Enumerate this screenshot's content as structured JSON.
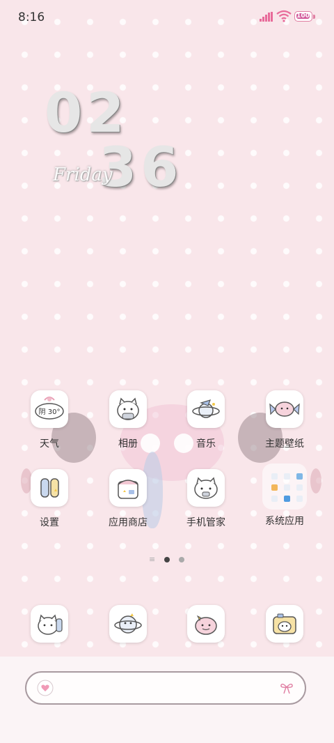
{
  "status_bar": {
    "time": "8:16",
    "battery": "100"
  },
  "clock": {
    "hours": "02",
    "minutes": "36",
    "day": "Friday"
  },
  "weather_widget": {
    "text": "阴 30°"
  },
  "apps_row1": [
    {
      "label": "天气",
      "icon": "weather-cloud-icon"
    },
    {
      "label": "相册",
      "icon": "gallery-cat-icon"
    },
    {
      "label": "音乐",
      "icon": "music-planet-icon"
    },
    {
      "label": "主题壁纸",
      "icon": "theme-candy-icon"
    }
  ],
  "apps_row2": [
    {
      "label": "设置",
      "icon": "settings-popsicle-icon"
    },
    {
      "label": "应用商店",
      "icon": "app-store-bag-icon"
    },
    {
      "label": "手机管家",
      "icon": "phone-manager-cat-icon"
    },
    {
      "label": "系统应用",
      "icon": "system-apps-folder-icon"
    }
  ],
  "dock": [
    {
      "icon": "phone-cat-icon"
    },
    {
      "icon": "messages-planet-icon"
    },
    {
      "icon": "browser-cat-icon"
    },
    {
      "icon": "camera-cat-icon"
    }
  ],
  "page_indicator": {
    "pages": 2,
    "current": 1
  },
  "search": {
    "placeholder": ""
  },
  "colors": {
    "background": "#f9e6ea",
    "accent": "#e07fa3"
  }
}
